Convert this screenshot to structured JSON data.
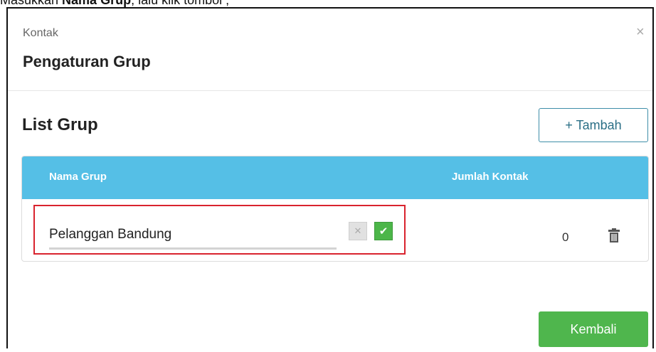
{
  "caption": {
    "prefix": "Masukkan ",
    "bold1": "Nama Grup",
    "middle": ", lalu klik tombol ",
    "suffix": ";"
  },
  "modal": {
    "breadcrumb": "Kontak",
    "title": "Pengaturan Grup",
    "close_label": "×"
  },
  "list": {
    "title": "List Grup",
    "add_label": "+ Tambah"
  },
  "table": {
    "headers": {
      "name": "Nama Grup",
      "count": "Jumlah Kontak"
    },
    "rows": [
      {
        "name_value": "Pelanggan Bandung",
        "count": "0"
      }
    ]
  },
  "footer": {
    "back_label": "Kembali"
  },
  "colors": {
    "header_blue": "#55bfe6",
    "green": "#4fb64d",
    "highlight_red": "#d9232e"
  }
}
